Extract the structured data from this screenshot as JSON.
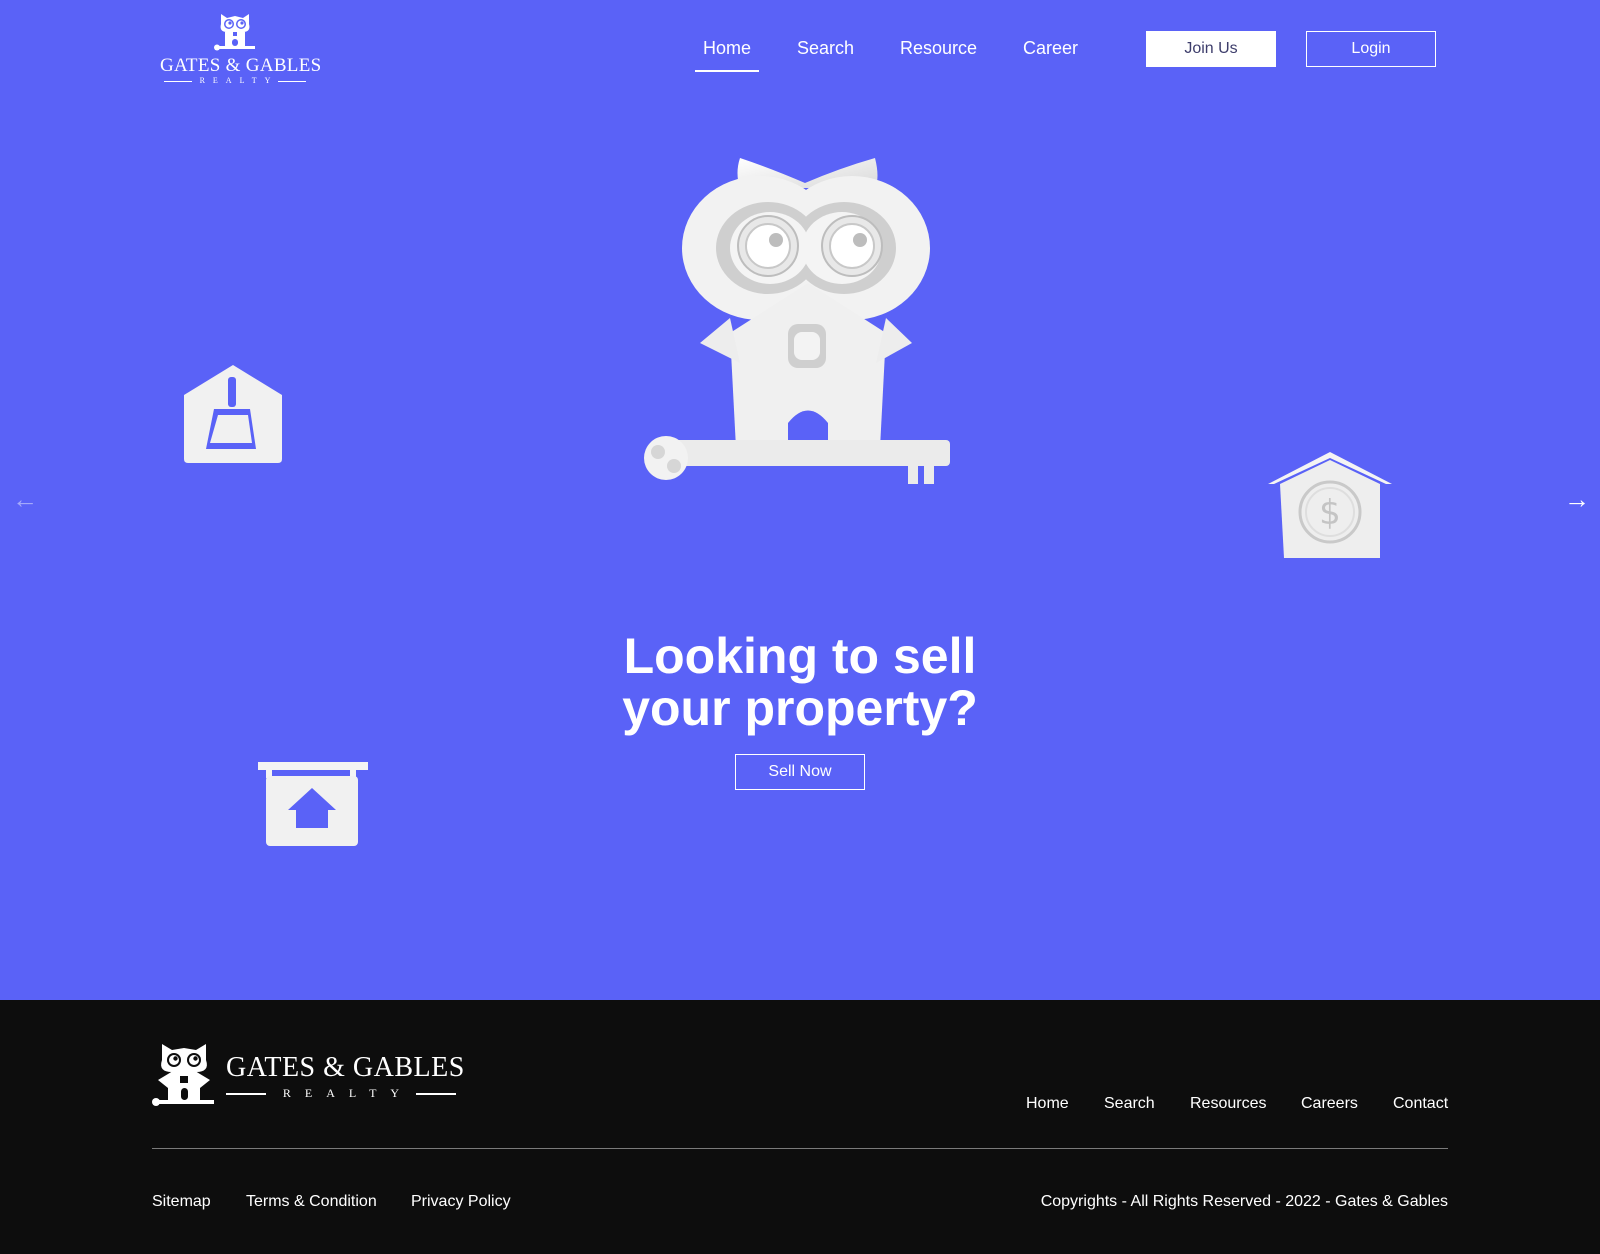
{
  "header": {
    "logo": {
      "brand": "GATES & GABLES",
      "sub": "REALTY"
    },
    "nav": [
      "Home",
      "Search",
      "Resource",
      "Career"
    ],
    "active_nav": "Home",
    "join_label": "Join Us",
    "login_label": "Login"
  },
  "hero": {
    "title_line1": "Looking to sell",
    "title_line2": "your property?",
    "cta_label": "Sell Now",
    "prev_icon": "arrow-left-icon",
    "next_icon": "arrow-right-icon"
  },
  "footer": {
    "logo": {
      "brand": "GATES & GABLES",
      "sub": "REALTY"
    },
    "nav": [
      "Home",
      "Search",
      "Resources",
      "Careers",
      "Contact"
    ],
    "bottom_links": [
      "Sitemap",
      "Terms & Condition",
      "Privacy Policy"
    ],
    "copyright": "Copyrights - All Rights Reserved - 2022 - Gates & Gables"
  },
  "colors": {
    "hero_bg": "#5a62f7",
    "footer_bg": "#0d0d0d",
    "text": "#ffffff"
  }
}
